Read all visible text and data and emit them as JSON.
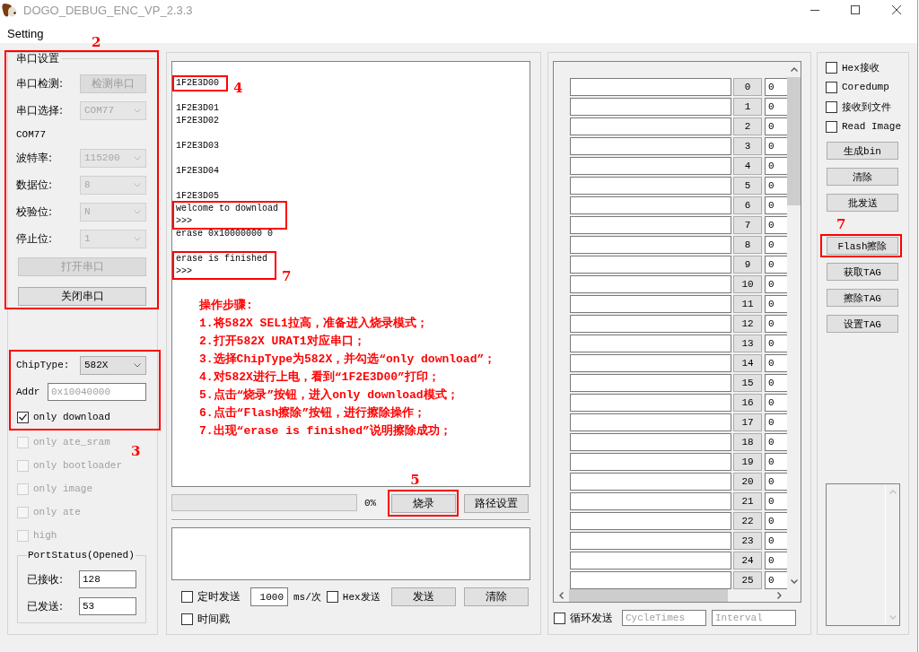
{
  "window": {
    "title": "DOGO_DEBUG_ENC_VP_2.3.3"
  },
  "menu": [
    {
      "label": "Setting"
    }
  ],
  "serial_settings": {
    "highlighted": true,
    "callout": "2",
    "title": "串口设置",
    "detect": {
      "label": "串口检测:",
      "button": "检测串口",
      "disabled": true
    },
    "port": {
      "label": "串口选择:",
      "value": "COM77",
      "disabled": true
    },
    "port_name": "COM77",
    "params": [
      {
        "label": "波特率:",
        "value": "115200",
        "disabled": true
      },
      {
        "label": "数据位:",
        "value": "8",
        "disabled": true
      },
      {
        "label": "校验位:",
        "value": "N",
        "disabled": true
      },
      {
        "label": "停止位:",
        "value": "1",
        "disabled": true
      }
    ],
    "buttons": [
      {
        "label": "打开串口",
        "disabled": true
      },
      {
        "label": "关闭串口",
        "disabled": false
      }
    ]
  },
  "chip": {
    "highlighted": true,
    "callout": "3",
    "chip_type": {
      "label": "ChipType:",
      "value": "582X"
    },
    "addr": {
      "label": "Addr",
      "placeholder": "0x10040000"
    },
    "option": {
      "label": "only download",
      "checked": true
    }
  },
  "options": [
    {
      "label": "only ate_sram",
      "checked": false,
      "disabled": true
    },
    {
      "label": "only bootloader",
      "checked": false,
      "disabled": true
    },
    {
      "label": "only image",
      "checked": false,
      "disabled": true
    },
    {
      "label": "only ate",
      "checked": false,
      "disabled": true
    },
    {
      "label": "high",
      "checked": false,
      "disabled": true
    }
  ],
  "port_status": {
    "title": "PortStatus(Opened)",
    "fields": [
      {
        "label": "已接收:",
        "value": "128"
      },
      {
        "label": "已发送:",
        "value": "53"
      }
    ]
  },
  "log": {
    "paragraphs": [
      {
        "groups": [
          {
            "lines": [
              "1F2E3D00"
            ],
            "highlighted": true,
            "callout": "4"
          }
        ]
      },
      {
        "groups": [
          {
            "lines": [
              "1F2E3D01",
              "1F2E3D02"
            ],
            "highlighted": false
          }
        ]
      },
      {
        "groups": [
          {
            "lines": [
              "1F2E3D03"
            ],
            "highlighted": false
          }
        ]
      },
      {
        "groups": [
          {
            "lines": [
              "1F2E3D04"
            ],
            "highlighted": false
          }
        ]
      },
      {
        "groups": [
          {
            "lines": [
              "1F2E3D05"
            ],
            "highlighted": false
          },
          {
            "lines": [
              "welcome to download",
              ">>>"
            ],
            "highlighted": true
          },
          {
            "lines": [
              "erase 0x10000000 0"
            ],
            "highlighted": false
          }
        ]
      },
      {
        "groups": [
          {
            "lines": [
              "erase is finished",
              ">>>"
            ],
            "highlighted": true,
            "callout": "7"
          }
        ]
      }
    ]
  },
  "instructions": {
    "title": "操作步骤:",
    "steps": [
      "1.将582X SEL1拉高，准备进入烧录模式；",
      "2.打开582X URAT1对应串口；",
      "3.选择ChipType为582X，并勾选“only download”；",
      "4.对582X进行上电，看到“1F2E3D00”打印；",
      "5.点击“烧录”按钮，进入only download模式；",
      "6.点击“Flash擦除”按钮，进行擦除操作；",
      "7.出现“erase is finished”说明擦除成功；"
    ]
  },
  "progress": {
    "level": 0,
    "reading": "0%"
  },
  "burn_buttons": [
    {
      "label": "烧录",
      "highlighted": true,
      "callout": "5"
    },
    {
      "label": "路径设置",
      "highlighted": false
    }
  ],
  "send": {
    "timed": {
      "label": "定时发送",
      "checked": false
    },
    "interval": "1000",
    "unit": "ms/次",
    "hex": {
      "label": "Hex发送",
      "checked": false
    },
    "buttons": [
      {
        "label": "发送"
      },
      {
        "label": "清除"
      }
    ],
    "timestamp": {
      "label": "时间戳",
      "checked": false
    }
  },
  "slots": {
    "rows": [
      {
        "index": "0",
        "value": "0"
      },
      {
        "index": "1",
        "value": "0"
      },
      {
        "index": "2",
        "value": "0"
      },
      {
        "index": "3",
        "value": "0"
      },
      {
        "index": "4",
        "value": "0"
      },
      {
        "index": "5",
        "value": "0"
      },
      {
        "index": "6",
        "value": "0"
      },
      {
        "index": "7",
        "value": "0"
      },
      {
        "index": "8",
        "value": "0"
      },
      {
        "index": "9",
        "value": "0"
      },
      {
        "index": "10",
        "value": "0"
      },
      {
        "index": "11",
        "value": "0"
      },
      {
        "index": "12",
        "value": "0"
      },
      {
        "index": "13",
        "value": "0"
      },
      {
        "index": "14",
        "value": "0"
      },
      {
        "index": "15",
        "value": "0"
      },
      {
        "index": "16",
        "value": "0"
      },
      {
        "index": "17",
        "value": "0"
      },
      {
        "index": "18",
        "value": "0"
      },
      {
        "index": "19",
        "value": "0"
      },
      {
        "index": "20",
        "value": "0"
      },
      {
        "index": "21",
        "value": "0"
      },
      {
        "index": "22",
        "value": "0"
      },
      {
        "index": "23",
        "value": "0"
      },
      {
        "index": "24",
        "value": "0"
      },
      {
        "index": "25",
        "value": "0"
      }
    ],
    "loop": {
      "label": "循环发送",
      "checked": false
    },
    "cycle_times": {
      "placeholder": "CycleTimes"
    },
    "interval": {
      "placeholder": "Interval"
    }
  },
  "receive_options": [
    {
      "label": "Hex接收",
      "checked": false
    },
    {
      "label": "Coredump",
      "checked": false
    },
    {
      "label": "接收到文件",
      "checked": false
    },
    {
      "label": "Read Image",
      "checked": false
    }
  ],
  "actions": [
    {
      "label": "生成bin",
      "highlighted": false
    },
    {
      "label": "清除",
      "highlighted": false
    },
    {
      "label": "批发送",
      "highlighted": false
    },
    {
      "label": "Flash擦除",
      "highlighted": true,
      "callout": "7"
    },
    {
      "label": "获取TAG",
      "highlighted": false
    },
    {
      "label": "擦除TAG",
      "highlighted": false
    },
    {
      "label": "设置TAG",
      "highlighted": false
    }
  ]
}
